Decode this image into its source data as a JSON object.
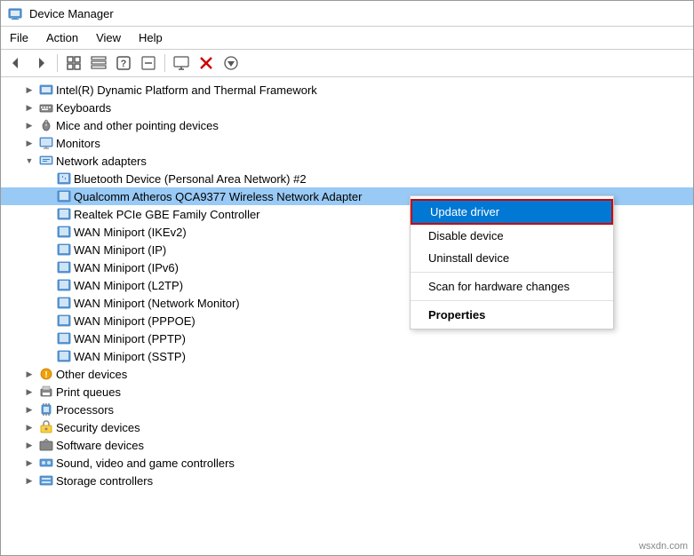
{
  "window": {
    "title": "Device Manager"
  },
  "menubar": {
    "items": [
      "File",
      "Action",
      "View",
      "Help"
    ]
  },
  "toolbar": {
    "buttons": [
      {
        "name": "back",
        "icon": "◀",
        "label": "Back"
      },
      {
        "name": "forward",
        "icon": "▶",
        "label": "Forward"
      },
      {
        "name": "icon1",
        "icon": "⊞",
        "label": ""
      },
      {
        "name": "icon2",
        "icon": "⊡",
        "label": ""
      },
      {
        "name": "icon3",
        "icon": "?",
        "label": "Help"
      },
      {
        "name": "icon4",
        "icon": "⊟",
        "label": ""
      },
      {
        "name": "icon5",
        "icon": "☰",
        "label": ""
      },
      {
        "name": "icon6",
        "icon": "✖",
        "label": ""
      },
      {
        "name": "icon7",
        "icon": "⊕",
        "label": ""
      }
    ]
  },
  "tree": {
    "items": [
      {
        "id": "intel",
        "level": 1,
        "expanded": false,
        "label": "Intel(R) Dynamic Platform and Thermal Framework",
        "icon": "chip"
      },
      {
        "id": "keyboards",
        "level": 1,
        "expanded": false,
        "label": "Keyboards",
        "icon": "keyboard"
      },
      {
        "id": "mice",
        "level": 1,
        "expanded": false,
        "label": "Mice and other pointing devices",
        "icon": "mouse"
      },
      {
        "id": "monitors",
        "level": 1,
        "expanded": false,
        "label": "Monitors",
        "icon": "monitor"
      },
      {
        "id": "network-adapters",
        "level": 1,
        "expanded": true,
        "label": "Network adapters",
        "icon": "network"
      },
      {
        "id": "bluetooth",
        "level": 2,
        "expanded": false,
        "label": "Bluetooth Device (Personal Area Network) #2",
        "icon": "network-card"
      },
      {
        "id": "qualcomm",
        "level": 2,
        "expanded": false,
        "label": "Qualcomm Atheros QCA9377 Wireless Network Adapter",
        "icon": "network-card",
        "selected": true
      },
      {
        "id": "realtek",
        "level": 2,
        "expanded": false,
        "label": "Realtek PCIe GBE Family Controller",
        "icon": "network-card"
      },
      {
        "id": "wan-ikev2",
        "level": 2,
        "expanded": false,
        "label": "WAN Miniport (IKEv2)",
        "icon": "network-card"
      },
      {
        "id": "wan-ip",
        "level": 2,
        "expanded": false,
        "label": "WAN Miniport (IP)",
        "icon": "network-card"
      },
      {
        "id": "wan-ipv6",
        "level": 2,
        "expanded": false,
        "label": "WAN Miniport (IPv6)",
        "icon": "network-card"
      },
      {
        "id": "wan-l2tp",
        "level": 2,
        "expanded": false,
        "label": "WAN Miniport (L2TP)",
        "icon": "network-card"
      },
      {
        "id": "wan-nm",
        "level": 2,
        "expanded": false,
        "label": "WAN Miniport (Network Monitor)",
        "icon": "network-card"
      },
      {
        "id": "wan-pppoe",
        "level": 2,
        "expanded": false,
        "label": "WAN Miniport (PPPOE)",
        "icon": "network-card"
      },
      {
        "id": "wan-pptp",
        "level": 2,
        "expanded": false,
        "label": "WAN Miniport (PPTP)",
        "icon": "network-card"
      },
      {
        "id": "wan-sstp",
        "level": 2,
        "expanded": false,
        "label": "WAN Miniport (SSTP)",
        "icon": "network-card"
      },
      {
        "id": "other-devices",
        "level": 1,
        "expanded": false,
        "label": "Other devices",
        "icon": "other"
      },
      {
        "id": "print-queues",
        "level": 1,
        "expanded": false,
        "label": "Print queues",
        "icon": "printer"
      },
      {
        "id": "processors",
        "level": 1,
        "expanded": false,
        "label": "Processors",
        "icon": "processor"
      },
      {
        "id": "security-devices",
        "level": 1,
        "expanded": false,
        "label": "Security devices",
        "icon": "security"
      },
      {
        "id": "software-devices",
        "level": 1,
        "expanded": false,
        "label": "Software devices",
        "icon": "software"
      },
      {
        "id": "sound",
        "level": 1,
        "expanded": false,
        "label": "Sound, video and game controllers",
        "icon": "sound"
      },
      {
        "id": "storage",
        "level": 1,
        "expanded": false,
        "label": "Storage controllers",
        "icon": "storage"
      }
    ]
  },
  "contextmenu": {
    "items": [
      {
        "id": "update-driver",
        "label": "Update driver",
        "active": true,
        "bold": false
      },
      {
        "id": "disable-device",
        "label": "Disable device",
        "bold": false
      },
      {
        "id": "uninstall-device",
        "label": "Uninstall device",
        "bold": false
      },
      {
        "id": "sep1",
        "type": "separator"
      },
      {
        "id": "scan",
        "label": "Scan for hardware changes",
        "bold": false
      },
      {
        "id": "sep2",
        "type": "separator"
      },
      {
        "id": "properties",
        "label": "Properties",
        "bold": true
      }
    ]
  },
  "watermark": "wsxdn.com"
}
